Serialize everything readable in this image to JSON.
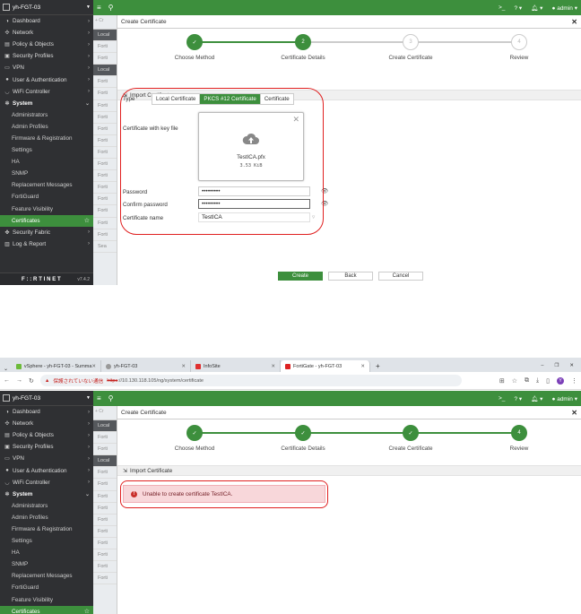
{
  "shot1": {
    "header": {
      "device": "yh-FGT-03"
    },
    "topbar": {
      "user": "admin"
    },
    "sidebar": {
      "items": [
        {
          "label": "Dashboard",
          "icon": "dashboard-icon"
        },
        {
          "label": "Network",
          "icon": "network-icon"
        },
        {
          "label": "Policy & Objects",
          "icon": "policy-icon"
        },
        {
          "label": "Security Profiles",
          "icon": "lock-icon"
        },
        {
          "label": "VPN",
          "icon": "monitor-icon"
        },
        {
          "label": "User & Authentication",
          "icon": "user-icon"
        },
        {
          "label": "WiFi Controller",
          "icon": "wifi-icon"
        },
        {
          "label": "System",
          "icon": "gear-icon"
        }
      ],
      "system_sub": [
        "Administrators",
        "Admin Profiles",
        "Firmware & Registration",
        "Settings",
        "HA",
        "SNMP",
        "Replacement Messages",
        "FortiGuard",
        "Feature Visibility",
        "Certificates"
      ],
      "after": [
        {
          "label": "Security Fabric",
          "icon": "fabric-icon"
        },
        {
          "label": "Log & Report",
          "icon": "chart-icon"
        }
      ],
      "brand": "F::RTINET",
      "version": "v7.4.2"
    },
    "list": {
      "create_label": "+ Cr",
      "rows": [
        "Local",
        "Forti",
        "Forti",
        "Local",
        "Forti",
        "Forti",
        "Forti",
        "Forti",
        "Forti",
        "Forti",
        "Forti",
        "Forti",
        "Forti",
        "Forti",
        "Forti",
        "Forti",
        "Forti",
        "Forti"
      ],
      "search_label": "Sea"
    },
    "dialog": {
      "title": "Create Certificate",
      "steps": [
        "Choose Method",
        "Certificate Details",
        "Create Certificate",
        "Review"
      ],
      "step_numbers": [
        "",
        "2",
        "3",
        "4"
      ],
      "section": "Import Certificate",
      "type_label": "Type",
      "type_options": [
        "Local Certificate",
        "PKCS #12 Certificate",
        "Certificate"
      ],
      "file_label": "Certificate with key file",
      "file_name": "TestICA.pfx",
      "file_size": "3.53 KiB",
      "password_label": "Password",
      "password_value": "•••••••••",
      "confirm_label": "Confirm password",
      "confirm_value": "•••••••••",
      "name_label": "Certificate name",
      "name_value": "TestICA",
      "buttons": {
        "create": "Create",
        "back": "Back",
        "cancel": "Cancel"
      }
    }
  },
  "shot2": {
    "chrome": {
      "tabs": [
        "vSphere - yh-FGT-03 - Summa",
        "yh-FGT-03",
        "InfoSite",
        "FortiGate - yh-FGT-03"
      ],
      "security_warning": "保護されていない通信",
      "url_scheme": "https",
      "url_rest": "://10.130.118.105/ng/system/certificate"
    },
    "header": {
      "device": "yh-FGT-03"
    },
    "topbar": {
      "user": "admin"
    },
    "list": {
      "create_label": "+ Cr",
      "rows": [
        "Local",
        "Forti",
        "Forti",
        "Local",
        "Forti",
        "Forti",
        "Forti",
        "Forti",
        "Forti",
        "Forti",
        "Forti",
        "Forti",
        "Forti",
        "Forti"
      ]
    },
    "dialog": {
      "title": "Create Certificate",
      "steps": [
        "Choose Method",
        "Certificate Details",
        "Create Certificate",
        "Review"
      ],
      "step_numbers": [
        "",
        "",
        "",
        "4"
      ],
      "section": "Import Certificate",
      "error": "Unable to create certificate TestICA."
    }
  },
  "colors": {
    "accent": "#3d8f3d",
    "sidebar_bg": "#2f3033",
    "highlight_red": "#e02020",
    "error_bg": "#f8d7da"
  }
}
